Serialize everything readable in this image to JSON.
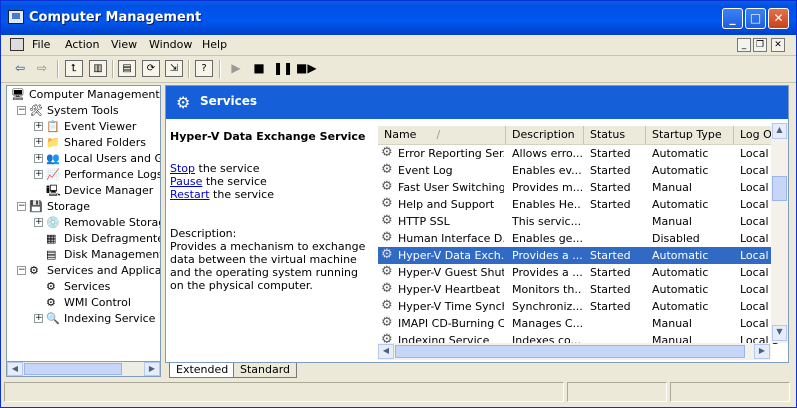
{
  "window": {
    "title": "Computer Management"
  },
  "menubar": {
    "items": [
      "File",
      "Action",
      "View",
      "Window",
      "Help"
    ]
  },
  "toolbar": {
    "icons": [
      "back-arrow-icon",
      "forward-arrow-icon",
      "up-folder-icon",
      "show-hide-tree-icon",
      "properties-icon",
      "refresh-icon",
      "export-list-icon",
      "help-icon",
      "start-service-icon",
      "stop-service-icon",
      "pause-service-icon",
      "restart-service-icon"
    ]
  },
  "tree": {
    "items": [
      {
        "label": "Computer Management (Lo",
        "indent": 0,
        "expander": ""
      },
      {
        "label": "System Tools",
        "indent": 1,
        "expander": "-"
      },
      {
        "label": "Event Viewer",
        "indent": 2,
        "expander": "+"
      },
      {
        "label": "Shared Folders",
        "indent": 2,
        "expander": "+"
      },
      {
        "label": "Local Users and Gro",
        "indent": 2,
        "expander": "+"
      },
      {
        "label": "Performance Logs a",
        "indent": 2,
        "expander": "+"
      },
      {
        "label": "Device Manager",
        "indent": 2,
        "expander": ""
      },
      {
        "label": "Storage",
        "indent": 1,
        "expander": "-"
      },
      {
        "label": "Removable Storage",
        "indent": 2,
        "expander": "+"
      },
      {
        "label": "Disk Defragmenter",
        "indent": 2,
        "expander": ""
      },
      {
        "label": "Disk Management",
        "indent": 2,
        "expander": ""
      },
      {
        "label": "Services and Applicatio",
        "indent": 1,
        "expander": "-"
      },
      {
        "label": "Services",
        "indent": 2,
        "expander": ""
      },
      {
        "label": "WMI Control",
        "indent": 2,
        "expander": ""
      },
      {
        "label": "Indexing Service",
        "indent": 2,
        "expander": "+"
      }
    ]
  },
  "services_panel": {
    "header": "Services",
    "selected_name": "Hyper-V Data Exchange Service",
    "actions": [
      {
        "link": "Stop",
        "rest": " the service"
      },
      {
        "link": "Pause",
        "rest": " the service"
      },
      {
        "link": "Restart",
        "rest": " the service"
      }
    ],
    "description_label": "Description:",
    "description": "Provides a mechanism to exchange data between the virtual machine and the operating system running on the physical computer."
  },
  "list": {
    "columns": [
      "Name",
      "Description",
      "Status",
      "Startup Type",
      "Log On"
    ],
    "rows": [
      {
        "name": "Error Reporting Ser...",
        "description": "Allows erro...",
        "status": "Started",
        "startup": "Automatic",
        "logon": "Local S"
      },
      {
        "name": "Event Log",
        "description": "Enables ev...",
        "status": "Started",
        "startup": "Automatic",
        "logon": "Local S"
      },
      {
        "name": "Fast User Switching...",
        "description": "Provides m...",
        "status": "Started",
        "startup": "Manual",
        "logon": "Local S"
      },
      {
        "name": "Help and Support",
        "description": "Enables He...",
        "status": "Started",
        "startup": "Automatic",
        "logon": "Local S"
      },
      {
        "name": "HTTP SSL",
        "description": "This servic...",
        "status": "",
        "startup": "Manual",
        "logon": "Local S"
      },
      {
        "name": "Human Interface D...",
        "description": "Enables ge...",
        "status": "",
        "startup": "Disabled",
        "logon": "Local S"
      },
      {
        "name": "Hyper-V Data Exch...",
        "description": "Provides a ...",
        "status": "Started",
        "startup": "Automatic",
        "logon": "Local S",
        "selected": true
      },
      {
        "name": "Hyper-V Guest Shut...",
        "description": "Provides a ...",
        "status": "Started",
        "startup": "Automatic",
        "logon": "Local S"
      },
      {
        "name": "Hyper-V Heartbeat ...",
        "description": "Monitors th...",
        "status": "Started",
        "startup": "Automatic",
        "logon": "Local S"
      },
      {
        "name": "Hyper-V Time Synch...",
        "description": "Synchroniz...",
        "status": "Started",
        "startup": "Automatic",
        "logon": "Local S"
      },
      {
        "name": "IMAPI CD-Burning C...",
        "description": "Manages C...",
        "status": "",
        "startup": "Manual",
        "logon": "Local S"
      },
      {
        "name": "Indexing Service",
        "description": "Indexes co...",
        "status": "",
        "startup": "Manual",
        "logon": "Local S"
      }
    ]
  },
  "tabs": [
    "Extended",
    "Standard"
  ]
}
